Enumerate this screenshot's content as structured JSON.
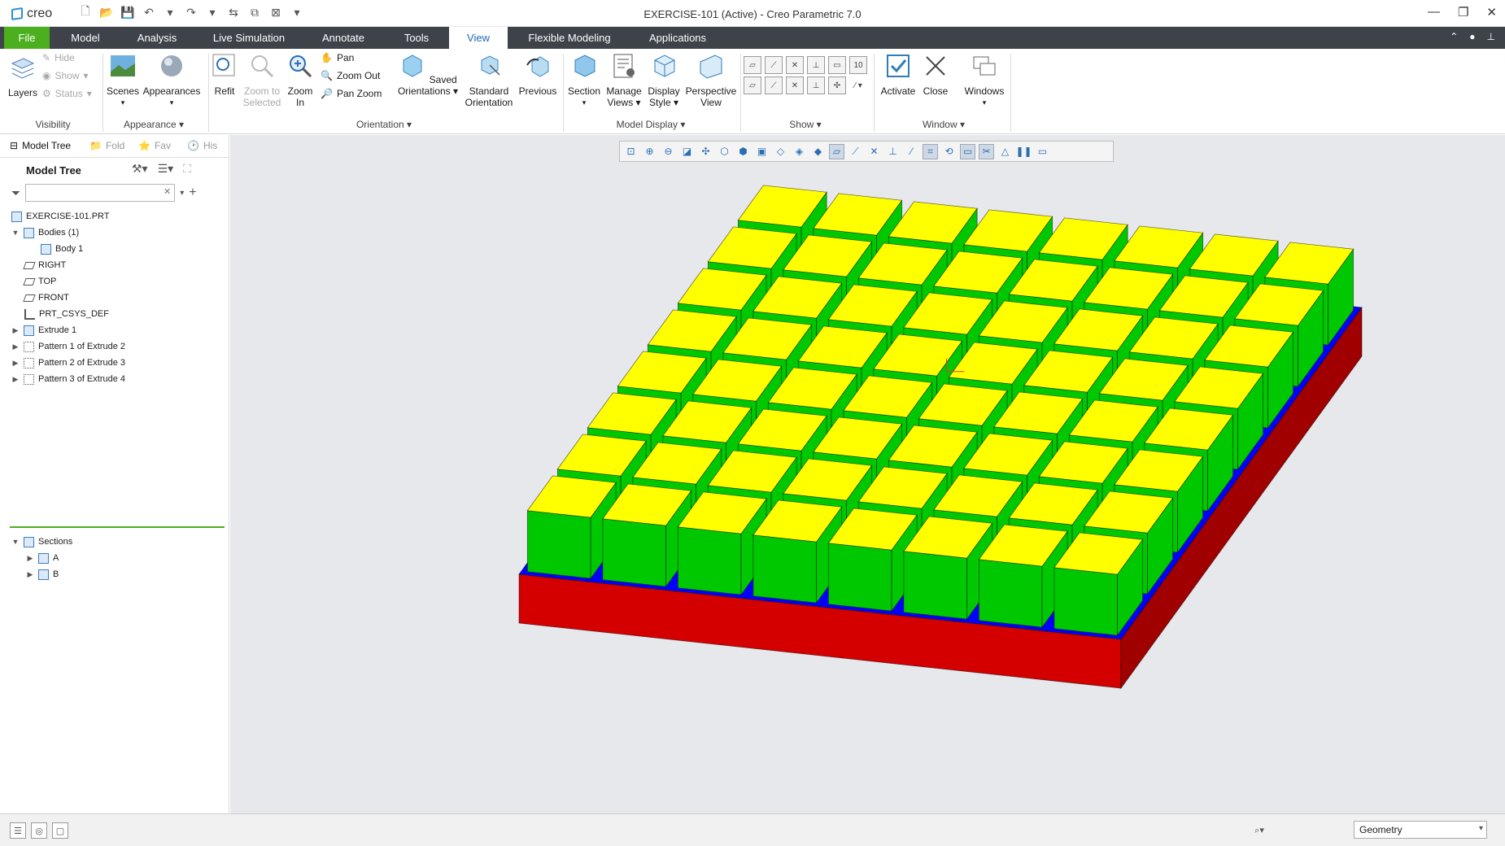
{
  "app": {
    "logo_text": "creo",
    "window_title": "EXERCISE-101 (Active) - Creo Parametric 7.0"
  },
  "tabs": [
    {
      "label": "File"
    },
    {
      "label": "Model"
    },
    {
      "label": "Analysis"
    },
    {
      "label": "Live Simulation"
    },
    {
      "label": "Annotate"
    },
    {
      "label": "Tools"
    },
    {
      "label": "View"
    },
    {
      "label": "Flexible Modeling"
    },
    {
      "label": "Applications"
    }
  ],
  "ribbon": {
    "visibility": {
      "layers": "Layers",
      "hide": "Hide",
      "show": "Show",
      "status": "Status",
      "group": "Visibility"
    },
    "appearance": {
      "scenes": "Scenes",
      "appearances": "Appearances",
      "group": "Appearance"
    },
    "orientation": {
      "refit": "Refit",
      "zoom_to_selected_1": "Zoom to",
      "zoom_to_selected_2": "Selected",
      "zoom_in_1": "Zoom",
      "zoom_in_2": "In",
      "pan": "Pan",
      "zoom_out": "Zoom Out",
      "pan_zoom": "Pan Zoom",
      "saved_1": "Saved",
      "saved_2": "Orientations",
      "standard_1": "Standard",
      "standard_2": "Orientation",
      "previous": "Previous",
      "group": "Orientation"
    },
    "model_display": {
      "section": "Section",
      "manage_1": "Manage",
      "manage_2": "Views",
      "display_1": "Display",
      "display_2": "Style",
      "perspective_1": "Perspective",
      "perspective_2": "View",
      "group": "Model Display"
    },
    "show": {
      "group": "Show"
    },
    "window": {
      "activate": "Activate",
      "close": "Close",
      "windows": "Windows",
      "group": "Window"
    }
  },
  "navigator": {
    "tabs": [
      "Model Tree",
      "Fold",
      "Fav",
      "His"
    ],
    "tree_title": "Model Tree",
    "search": {
      "value": "",
      "placeholder": ""
    }
  },
  "tree": [
    {
      "label": "EXERCISE-101.PRT"
    },
    {
      "label": "Bodies (1)"
    },
    {
      "label": "Body 1"
    },
    {
      "label": "RIGHT"
    },
    {
      "label": "TOP"
    },
    {
      "label": "FRONT"
    },
    {
      "label": "PRT_CSYS_DEF"
    },
    {
      "label": "Extrude 1"
    },
    {
      "label": "Pattern 1 of Extrude 2"
    },
    {
      "label": "Pattern 2 of Extrude 3"
    },
    {
      "label": "Pattern 3 of Extrude 4"
    }
  ],
  "sections": [
    {
      "label": "Sections"
    },
    {
      "label": "A"
    },
    {
      "label": "B"
    }
  ],
  "statusbar": {
    "filter_value": "Geometry"
  },
  "colors": {
    "cube_top": "#ffff00",
    "cube_side": "#00c800",
    "channel": "#0000ff",
    "base_front": "#d40000",
    "base_side": "#a00000",
    "accent": "#4caf1d"
  }
}
